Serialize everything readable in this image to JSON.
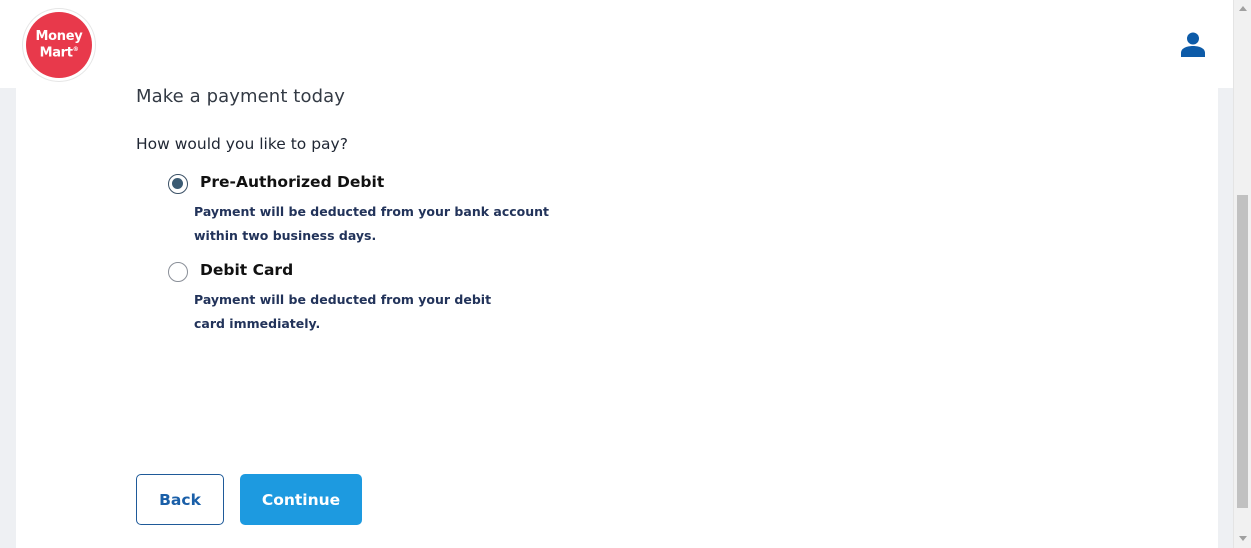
{
  "header": {
    "logo": {
      "line1": "Money",
      "line2": "Mart",
      "mark": "®"
    },
    "user_icon": "user-icon",
    "brand_color": "#e8394b"
  },
  "main": {
    "title": "Make a payment today",
    "question": "How would you like to pay?",
    "options": [
      {
        "label": "Pre-Authorized Debit",
        "description": "Payment will be deducted from your bank account within two business days.",
        "selected": true
      },
      {
        "label": "Debit Card",
        "description": "Payment will be deducted from your debit card immediately.",
        "selected": false
      }
    ]
  },
  "actions": {
    "back_label": "Back",
    "continue_label": "Continue",
    "continue_color": "#1d9ae0"
  }
}
